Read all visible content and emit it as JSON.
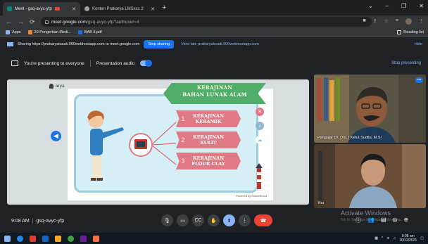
{
  "browser": {
    "tabs": [
      {
        "label": "Meet - gsq-avyc-yfp"
      },
      {
        "label": "Konten Prakarya LMSxxx 2"
      }
    ],
    "url_host": "meet.google.com",
    "url_path": "/gsq-avyc-yfp?authuser=4",
    "bookmarks": [
      {
        "label": "Apps"
      },
      {
        "label": "20 Pengertian Medi..."
      },
      {
        "label": "BAB II.pdf"
      }
    ],
    "reading_list": "Reading list"
  },
  "share_bar": {
    "text": "Sharing https://prakaryalusak.000webhostapp.com to meet.google.com",
    "stop_label": "Stop sharing",
    "switch_label": "View tab: prakaryalusak.000webhostapp.com",
    "hide_label": "Hide"
  },
  "presenting_bar": {
    "text": "You're presenting to everyone",
    "audio_label": "Presentation audio",
    "stop_label": "Stop presenting"
  },
  "slide": {
    "presenter_name": "arya",
    "title_line1": "KERAJINAN",
    "title_line2": "BAHAN LUNAK ALAM",
    "items": [
      {
        "num": "1",
        "line1": "KERAJINAN",
        "line2": "KERAMIK"
      },
      {
        "num": "2",
        "line1": "KERAJINAN",
        "line2": "KULIT"
      },
      {
        "num": "3",
        "line1": "KERAJINAN",
        "line2": "FLOUR CLAY"
      }
    ],
    "powered_by": "Powered by  000webhost"
  },
  "participants": [
    {
      "name": "Pengajar Dr. Drs. I Ketut Sudita, M.Si"
    },
    {
      "name": "You"
    }
  ],
  "meeting": {
    "time": "9:08 AM",
    "separator": "|",
    "code": "gsq-avyc-yfp"
  },
  "watermark": {
    "title": "Activate Windows",
    "subtitle": "Go to Settings to activate Windows."
  },
  "taskbar": {
    "clock_time": "9:08 am",
    "clock_date": "10/12/2021"
  },
  "colors": {
    "accent": "#1a73e8",
    "hangup": "#ea4335",
    "craft_pink": "#e07b86",
    "ribbon_green": "#4fae6a"
  }
}
